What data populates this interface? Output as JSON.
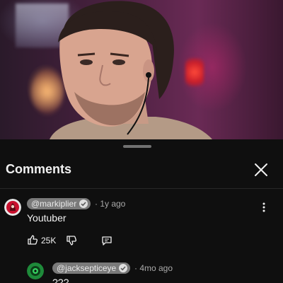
{
  "sheet": {
    "title": "Comments"
  },
  "comments": [
    {
      "author": "@markiplier",
      "time": "· 1y ago",
      "text": "Youtuber",
      "likes": "25K",
      "verified": true
    },
    {
      "author": "@jacksepticeye",
      "time": "· 4mo ago",
      "text": "???",
      "verified": true
    }
  ],
  "icons": {
    "close": "close-icon",
    "more": "more-vert-icon",
    "like": "thumb-up-icon",
    "dislike": "thumb-down-icon",
    "reply": "reply-icon",
    "verified": "verified-check-icon"
  },
  "colors": {
    "background": "#0f0f0f",
    "pill": "#7a7a7a",
    "muted_text": "#aaaaaa",
    "primary_text": "#f1f1f1"
  }
}
